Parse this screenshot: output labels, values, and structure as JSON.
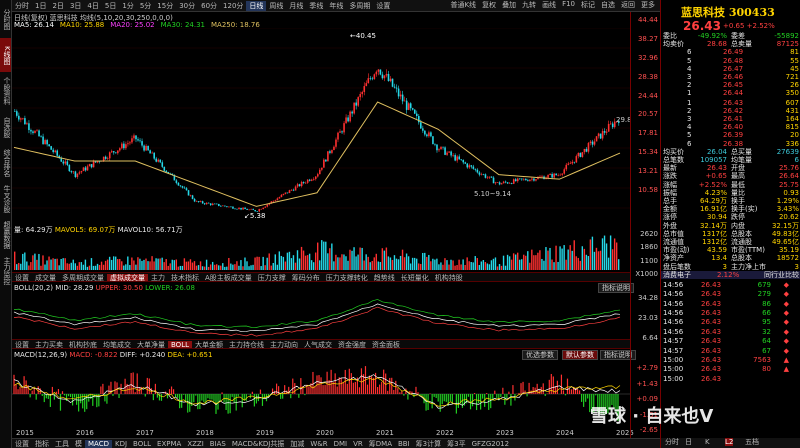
{
  "left_rail": [
    "分时图",
    "K线图",
    "个股资料",
    "自选股",
    "综合排名",
    "牛叉诊股",
    "超赢数据",
    "主力监控"
  ],
  "toolbar": {
    "periods": [
      "分时",
      "1日",
      "2日",
      "3日",
      "4日",
      "5日",
      "1分",
      "5分",
      "15分",
      "30分",
      "60分",
      "120分",
      "日线",
      "周线",
      "月线",
      "季线",
      "年线",
      "多周期",
      "设置"
    ],
    "active_period": "日线",
    "right_tools": [
      "普通K线",
      "复权",
      "叠加",
      "九转",
      "画线",
      "F10",
      "标记",
      "自选",
      "返回",
      "更多"
    ]
  },
  "stock_title": "日线(复权) 蓝思科技 均线(5,10,20,30,250,0,0,0)",
  "ma_values": [
    {
      "label": "MA5: 26.14",
      "color": "#ffffff"
    },
    {
      "label": "MA10: 25.88",
      "color": "#ffd400"
    },
    {
      "label": "MA20: 25.02",
      "color": "#ff40ff"
    },
    {
      "label": "MA30: 24.31",
      "color": "#22d022"
    },
    {
      "label": "MA250: 18.76",
      "color": "#e0c060"
    }
  ],
  "price_axis": [
    "44.44",
    "38.27",
    "32.96",
    "28.38",
    "24.44",
    "20.57",
    "17.81",
    "15.34",
    "13.21",
    "10.58"
  ],
  "annotations": {
    "high": "40.45",
    "low": "5.38",
    "mid": "5.10~9.14",
    "cur": "29.8"
  },
  "volume_pane": {
    "label": "量: 64.29万",
    "mavol5": "MAVOL5: 69.07万",
    "mavol10": "MAVOL10: 56.71万",
    "axis": [
      "2620",
      "1860",
      "1100",
      "X1000"
    ]
  },
  "tabs1": [
    "设置",
    "成交量",
    "多周期成交量",
    "虚拟成交量",
    "主力",
    "技术指标",
    "A股主板成交量",
    "压力支撑",
    "筹码分布",
    "压力支撑转化",
    "趋势线",
    "长短量化",
    "机构持股"
  ],
  "tabs1_active": "虚拟成交量",
  "boll_pane": {
    "label": "BOLL(20,2)",
    "mid": "MID: 28.29",
    "upper": "UPPER: 30.50",
    "lower": "LOWER: 26.08",
    "btn": "指标说明",
    "axis": [
      "34.28",
      "23.03",
      "6.64"
    ]
  },
  "tabs2": [
    "设置",
    "主力买卖",
    "机构抄底",
    "均笔成交",
    "大单净量",
    "BOLL",
    "大单金额",
    "主力持仓线",
    "主力动向",
    "人气成交",
    "资金强度",
    "资金面板"
  ],
  "tabs2_active": "BOLL",
  "macd_pane": {
    "label": "MACD(12,26,9)",
    "macd": "MACD: -0.822",
    "diff": "DIFF: +0.240",
    "dea": "DEA: +0.651",
    "btn1": "优选参数",
    "btn2": "默认参数",
    "btn3": "指标说明",
    "axis": [
      "+2.79",
      "+1.43",
      "+0.09",
      "-1.31",
      "-2.65"
    ]
  },
  "years": [
    "2015",
    "2016",
    "2017",
    "2018",
    "2019",
    "2020",
    "2021",
    "2022",
    "2023",
    "2024",
    "2025"
  ],
  "bottom_tabs": [
    "设置",
    "指标",
    "工具",
    "模",
    "MACD",
    "KDJ",
    "BOLL",
    "EXPMA",
    "XZZI",
    "BIAS",
    "MACD&KDJ共振",
    "加减",
    "W&R",
    "DMI",
    "VR",
    "筹DMA",
    "BBI",
    "筹3计算",
    "筹3平",
    "GFZG2012"
  ],
  "bottom_active": "MACD",
  "right_panel": {
    "name": "蓝思科技 300433",
    "price": "26.43",
    "chg": "+0.65  +2.52%",
    "header_rows": [
      {
        "l": "委比",
        "v": "-49.92%",
        "l2": "委差",
        "v2": "-55892"
      },
      {
        "l": "均卖价",
        "v": "28.68",
        "l2": "总卖量",
        "v2": "87125"
      }
    ],
    "asks": [
      {
        "n": "6",
        "p": "26.49",
        "q": "81"
      },
      {
        "n": "5",
        "p": "26.48",
        "q": "55"
      },
      {
        "n": "4",
        "p": "26.47",
        "q": "45"
      },
      {
        "n": "3",
        "p": "26.46",
        "q": "721"
      },
      {
        "n": "2",
        "p": "26.45",
        "q": "26"
      },
      {
        "n": "1",
        "p": "26.44",
        "q": "350"
      }
    ],
    "bids": [
      {
        "n": "1",
        "p": "26.43",
        "q": "607"
      },
      {
        "n": "2",
        "p": "26.42",
        "q": "431"
      },
      {
        "n": "3",
        "p": "26.41",
        "q": "164"
      },
      {
        "n": "4",
        "p": "26.40",
        "q": "815"
      },
      {
        "n": "5",
        "p": "26.39",
        "q": "20"
      },
      {
        "n": "6",
        "p": "26.38",
        "q": "336"
      }
    ],
    "mid_rows": [
      {
        "l": "均买价",
        "v": "26.04",
        "l2": "总买量",
        "v2": "27639"
      },
      {
        "l": "总笔数",
        "v": "109057",
        "l2": "均笔量",
        "v2": "6"
      }
    ],
    "stats": [
      {
        "l": "最新",
        "v": "26.43",
        "l2": "开盘",
        "v2": "25.76"
      },
      {
        "l": "涨跌",
        "v": "+0.65",
        "l2": "最高",
        "v2": "26.64"
      },
      {
        "l": "涨幅",
        "v": "+2.52%",
        "l2": "最低",
        "v2": "25.75"
      },
      {
        "l": "振幅",
        "v": "4.23%",
        "l2": "量比",
        "v2": "0.93"
      },
      {
        "l": "总手",
        "v": "64.29万",
        "l2": "换手",
        "v2": "1.29%"
      },
      {
        "l": "金额",
        "v": "16.91亿",
        "l2": "换手(实)",
        "v2": "3.43%"
      },
      {
        "l": "涨停",
        "v": "30.94",
        "l2": "跌停",
        "v2": "20.62"
      },
      {
        "l": "外盘",
        "v": "32.14万",
        "l2": "内盘",
        "v2": "32.15万"
      },
      {
        "l": "总市值",
        "v": "1317亿",
        "l2": "总股本",
        "v2": "49.83亿"
      },
      {
        "l": "流通值",
        "v": "1312亿",
        "l2": "流通股",
        "v2": "49.65亿"
      },
      {
        "l": "市盈(动)",
        "v": "43.59",
        "l2": "市盈(TTM)",
        "v2": "35.19"
      },
      {
        "l": "净资产",
        "v": "13.4",
        "l2": "总股本",
        "v2": "18572"
      },
      {
        "l": "盘后笔数",
        "v": "3",
        "l2": "主力净上市",
        "v2": "3"
      }
    ],
    "sector": {
      "l": "消费电子",
      "v": "2.12%",
      "v2": "同行业比较"
    },
    "ticks": [
      {
        "t": "14:56",
        "p": "26.43",
        "v": "679",
        "d": "sell"
      },
      {
        "t": "14:56",
        "p": "26.43",
        "v": "279",
        "d": "sell"
      },
      {
        "t": "14:56",
        "p": "26.43",
        "v": "86",
        "d": "sell"
      },
      {
        "t": "14:56",
        "p": "26.43",
        "v": "66",
        "d": "sell"
      },
      {
        "t": "14:56",
        "p": "26.43",
        "v": "95",
        "d": "sell"
      },
      {
        "t": "14:56",
        "p": "26.43",
        "v": "32",
        "d": "sell"
      },
      {
        "t": "14:57",
        "p": "26.43",
        "v": "64",
        "d": "sell"
      },
      {
        "t": "14:57",
        "p": "26.43",
        "v": "67",
        "d": "sell"
      },
      {
        "t": "15:00",
        "p": "26.43",
        "v": "7563",
        "d": "buy"
      },
      {
        "t": "15:00",
        "p": "26.43",
        "v": "80",
        "d": "buy"
      },
      {
        "t": "15:00",
        "p": "26.43",
        "v": "",
        "d": ""
      }
    ],
    "footer": [
      "分时",
      "日",
      "K",
      "L2",
      "五档"
    ]
  },
  "watermark": "雪球 · 自来也V",
  "chart_data": [
    {
      "type": "line",
      "title": "日线(复权) 蓝思科技",
      "ylim": [
        4,
        45
      ],
      "x": [
        "2015",
        "2016",
        "2017",
        "2018",
        "2019",
        "2020",
        "2021",
        "2022",
        "2023",
        "2024",
        "2025"
      ],
      "series": [
        {
          "name": "Close",
          "values": [
            28,
            14,
            22,
            8,
            6,
            14,
            38,
            20,
            12,
            14,
            26.43
          ]
        },
        {
          "name": "MA250",
          "values": [
            20,
            17,
            17,
            12,
            7,
            10,
            30,
            24,
            14,
            13,
            18.76
          ]
        }
      ]
    },
    {
      "type": "bar",
      "title": "量",
      "x": [
        "2015",
        "2016",
        "2017",
        "2018",
        "2019",
        "2020",
        "2021",
        "2022",
        "2023",
        "2024",
        "2025"
      ],
      "values": [
        900,
        500,
        700,
        500,
        600,
        1400,
        1100,
        700,
        600,
        1300,
        1860
      ]
    },
    {
      "type": "line",
      "title": "MACD(12,26,9)",
      "ylim": [
        -2.65,
        2.79
      ],
      "x": [
        "2015",
        "2016",
        "2017",
        "2018",
        "2019",
        "2020",
        "2021",
        "2022",
        "2023",
        "2024",
        "2025"
      ],
      "series": [
        {
          "name": "DIFF",
          "values": [
            1.2,
            -0.8,
            0.9,
            -1.1,
            -0.5,
            1.1,
            1.8,
            -1.2,
            -0.6,
            0.7,
            0.24
          ]
        },
        {
          "name": "DEA",
          "values": [
            1.0,
            -0.6,
            0.7,
            -0.9,
            -0.4,
            0.9,
            1.5,
            -1.0,
            -0.5,
            0.5,
            0.651
          ]
        }
      ]
    }
  ]
}
